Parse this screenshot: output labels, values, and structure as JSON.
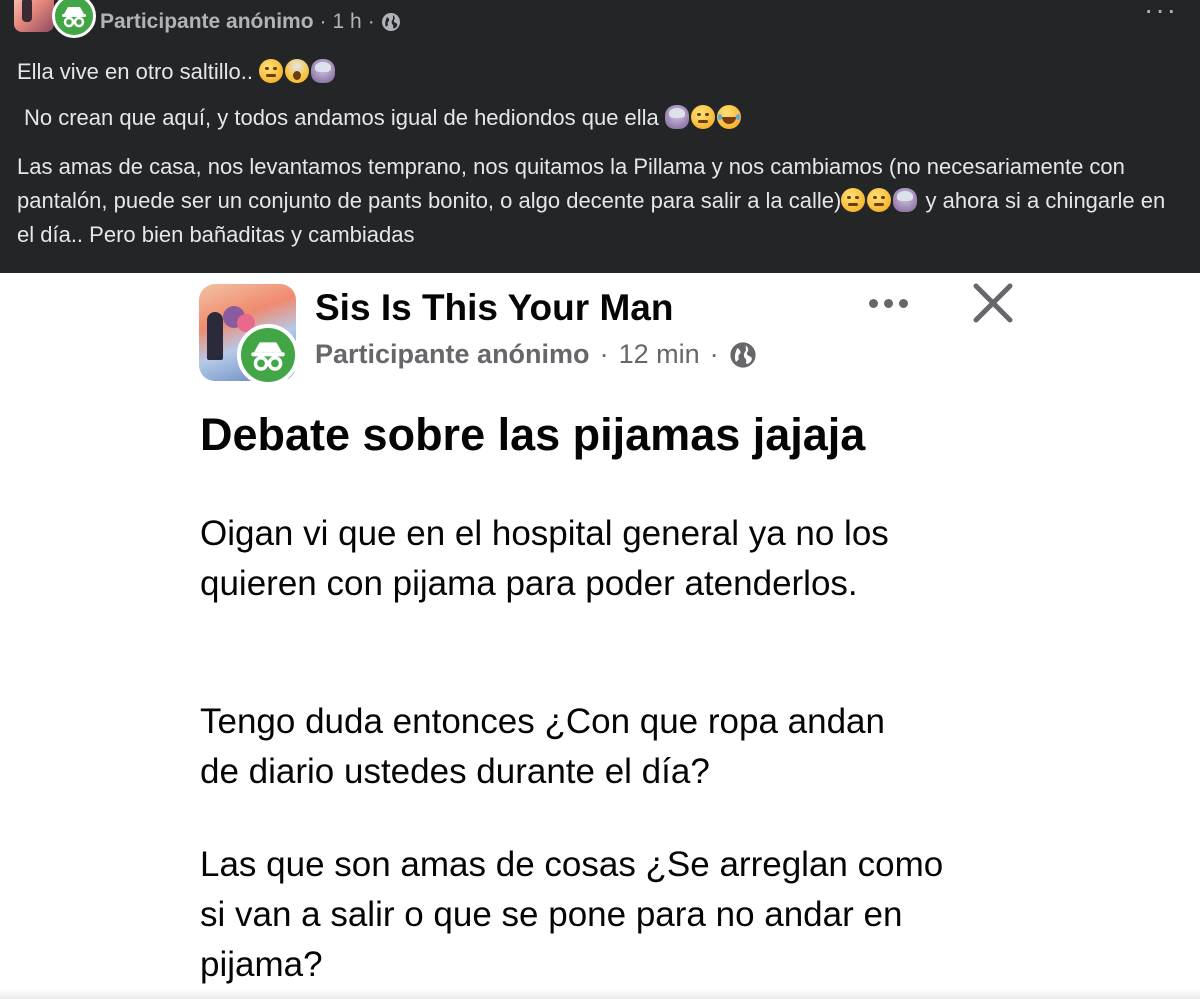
{
  "comment": {
    "author": "Participante anónimo",
    "separator": "·",
    "time": "1 h",
    "more_label": "···",
    "paragraphs": [
      "Ella vive en otro saltillo..",
      "No crean que aquí, y todos andamos igual de hediondos que ella",
      "Las amas de casa, nos levantamos temprano, nos quitamos la Pillama y nos cambiamos (no necesariamente con pantalón, puede ser un conjunto de pants bonito, o algo decente para salir a la calle)",
      "y ahora si a chingarle en el día.. Pero bien bañaditas y cambiadas"
    ],
    "icons": [
      "avatar-photo",
      "anonymous-icon",
      "globe-icon",
      "unamused-face-emoji",
      "screaming-face-emoji",
      "person-facepalming-emoji",
      "hand-over-mouth-emoji",
      "tears-of-joy-emoji"
    ]
  },
  "post": {
    "group_name": "Sis Is This Your Man",
    "author": "Participante anónimo",
    "separator": "·",
    "time": "12 min",
    "title": "Debate sobre las pijamas jajaja",
    "body_lines": [
      "Oigan vi que en el hospital general ya no los",
      "quieren con pijama para poder atenderlos.",
      "Tengo duda entonces ¿Con que ropa andan",
      "de diario ustedes durante el día?",
      "Las que son amas de cosas ¿Se arreglan como",
      "si van a salir o que se pone para no andar en",
      "pijama?"
    ],
    "icons": [
      "group-photo",
      "anonymous-icon",
      "globe-icon",
      "more-icon",
      "close-icon"
    ]
  },
  "colors": {
    "dark_background": "#242526",
    "dark_text": "#e4e6eb",
    "secondary_text": "#b0b3b8",
    "meta_text": "#65676b",
    "anonymous_green": "#42a546",
    "primary_text": "#050505"
  }
}
